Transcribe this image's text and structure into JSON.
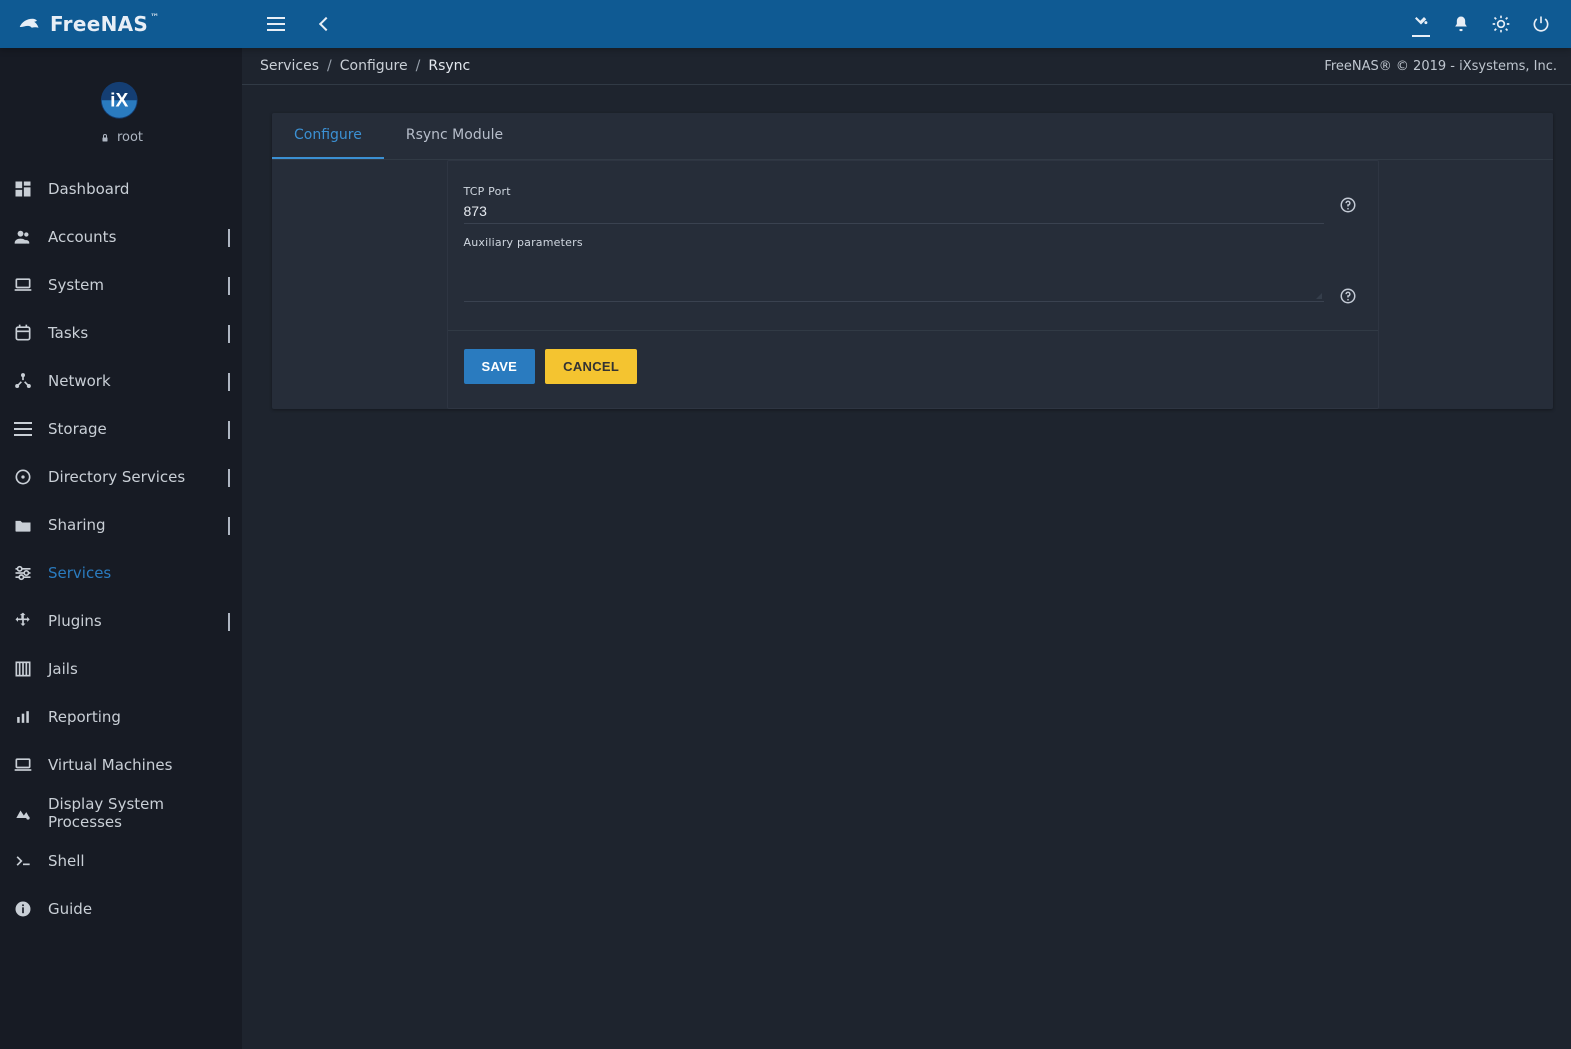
{
  "brand": {
    "name": "FreeNAS",
    "tm": "™",
    "copyright": "FreeNAS® © 2019 - iXsystems, Inc."
  },
  "user": {
    "name": "root"
  },
  "breadcrumb": {
    "items": [
      {
        "label": "Services"
      },
      {
        "label": "Configure"
      },
      {
        "label": "Rsync"
      }
    ]
  },
  "tabs": {
    "items": [
      {
        "label": "Configure",
        "active": true
      },
      {
        "label": "Rsync Module",
        "active": false
      }
    ]
  },
  "form": {
    "tcp_port": {
      "label": "TCP Port",
      "value": "873"
    },
    "aux_params": {
      "label": "Auxiliary parameters",
      "value": ""
    },
    "buttons": {
      "save": "SAVE",
      "cancel": "CANCEL"
    }
  },
  "sidebar": {
    "items": [
      {
        "label": "Dashboard",
        "icon": "dashboard",
        "expandable": false,
        "active": false
      },
      {
        "label": "Accounts",
        "icon": "accounts",
        "expandable": true,
        "active": false
      },
      {
        "label": "System",
        "icon": "laptop",
        "expandable": true,
        "active": false
      },
      {
        "label": "Tasks",
        "icon": "calendar",
        "expandable": true,
        "active": false
      },
      {
        "label": "Network",
        "icon": "hub",
        "expandable": true,
        "active": false
      },
      {
        "label": "Storage",
        "icon": "storage",
        "expandable": true,
        "active": false
      },
      {
        "label": "Directory Services",
        "icon": "vinyl",
        "expandable": true,
        "active": false
      },
      {
        "label": "Sharing",
        "icon": "folder-share",
        "expandable": true,
        "active": false
      },
      {
        "label": "Services",
        "icon": "tune",
        "expandable": false,
        "active": true
      },
      {
        "label": "Plugins",
        "icon": "plugin",
        "expandable": true,
        "active": false
      },
      {
        "label": "Jails",
        "icon": "jail",
        "expandable": false,
        "active": false
      },
      {
        "label": "Reporting",
        "icon": "bar-chart",
        "expandable": false,
        "active": false
      },
      {
        "label": "Virtual Machines",
        "icon": "laptop",
        "expandable": false,
        "active": false
      },
      {
        "label": "Display System Processes",
        "icon": "processes",
        "expandable": false,
        "active": false,
        "multiline": true
      },
      {
        "label": "Shell",
        "icon": "terminal",
        "expandable": false,
        "active": false
      },
      {
        "label": "Guide",
        "icon": "info",
        "expandable": false,
        "active": false
      }
    ]
  },
  "icons": {
    "theme": "format-color-fill",
    "notifications": "bell",
    "settings": "gear",
    "power": "power"
  }
}
